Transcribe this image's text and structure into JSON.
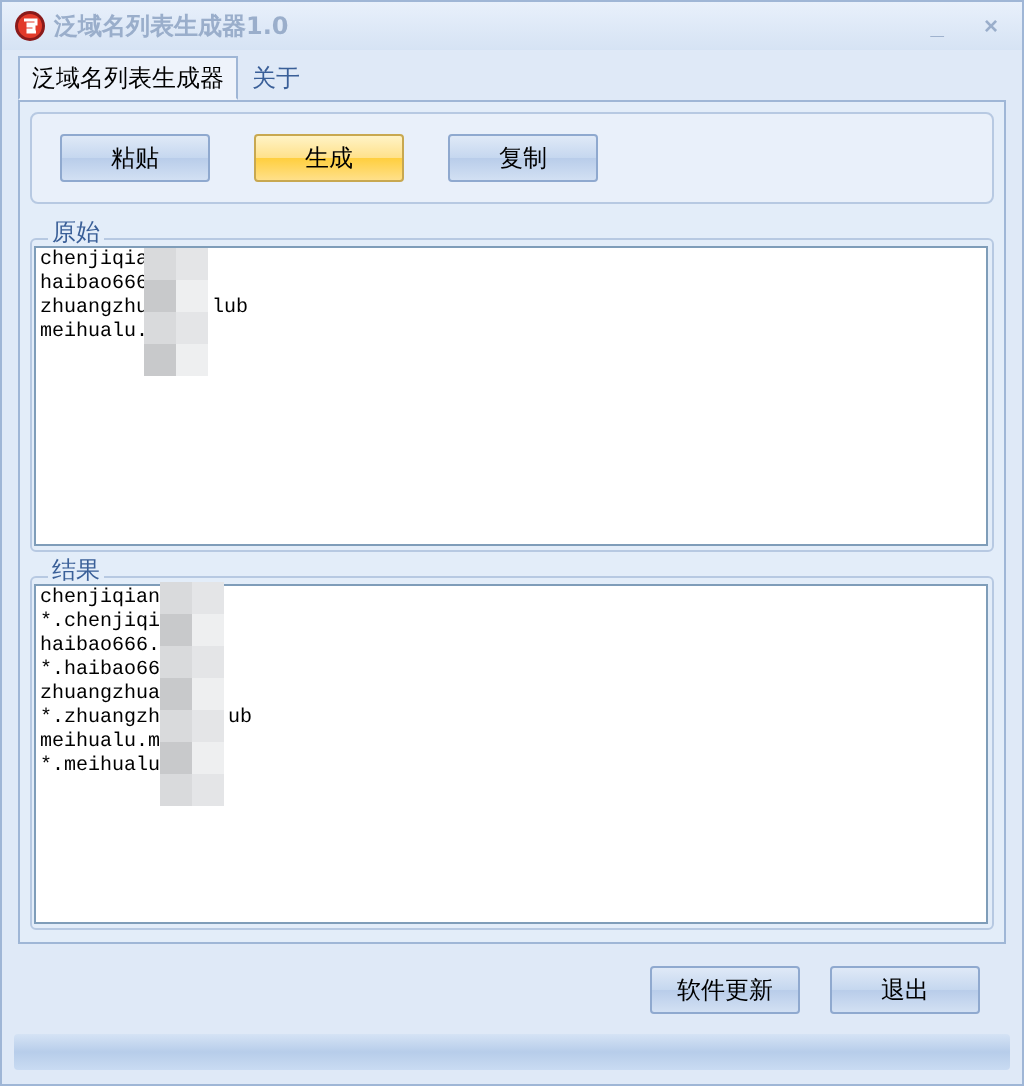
{
  "window": {
    "title": "泛域名列表生成器1.0",
    "controls": [
      "_",
      "×"
    ]
  },
  "tabs": [
    {
      "label": "泛域名列表生成器",
      "selected": true
    },
    {
      "label": "关于",
      "selected": false
    }
  ],
  "actions": [
    {
      "label": "粘贴",
      "selected": false
    },
    {
      "label": "生成",
      "selected": true
    },
    {
      "label": "复制",
      "selected": false
    }
  ],
  "source": {
    "label": "原始",
    "lines": [
      {
        "left": "chenjiqia"
      },
      {
        "left": "haibao666"
      },
      {
        "left": "zhuangzhu",
        "right": "lub"
      },
      {
        "left": "meihualu."
      }
    ]
  },
  "result": {
    "label": "结果",
    "lines": [
      {
        "left": "chenjiqian"
      },
      {
        "left": "*.chenjiqi"
      },
      {
        "left": "haibao666."
      },
      {
        "left": "*.haibao66"
      },
      {
        "left": "zhuangzhua"
      },
      {
        "left": "*.zhuangzh",
        "right": "ub"
      },
      {
        "left": "meihualu.m"
      },
      {
        "left": "*.meihualu"
      }
    ]
  },
  "footer_buttons": [
    "软件更新",
    "退出"
  ]
}
